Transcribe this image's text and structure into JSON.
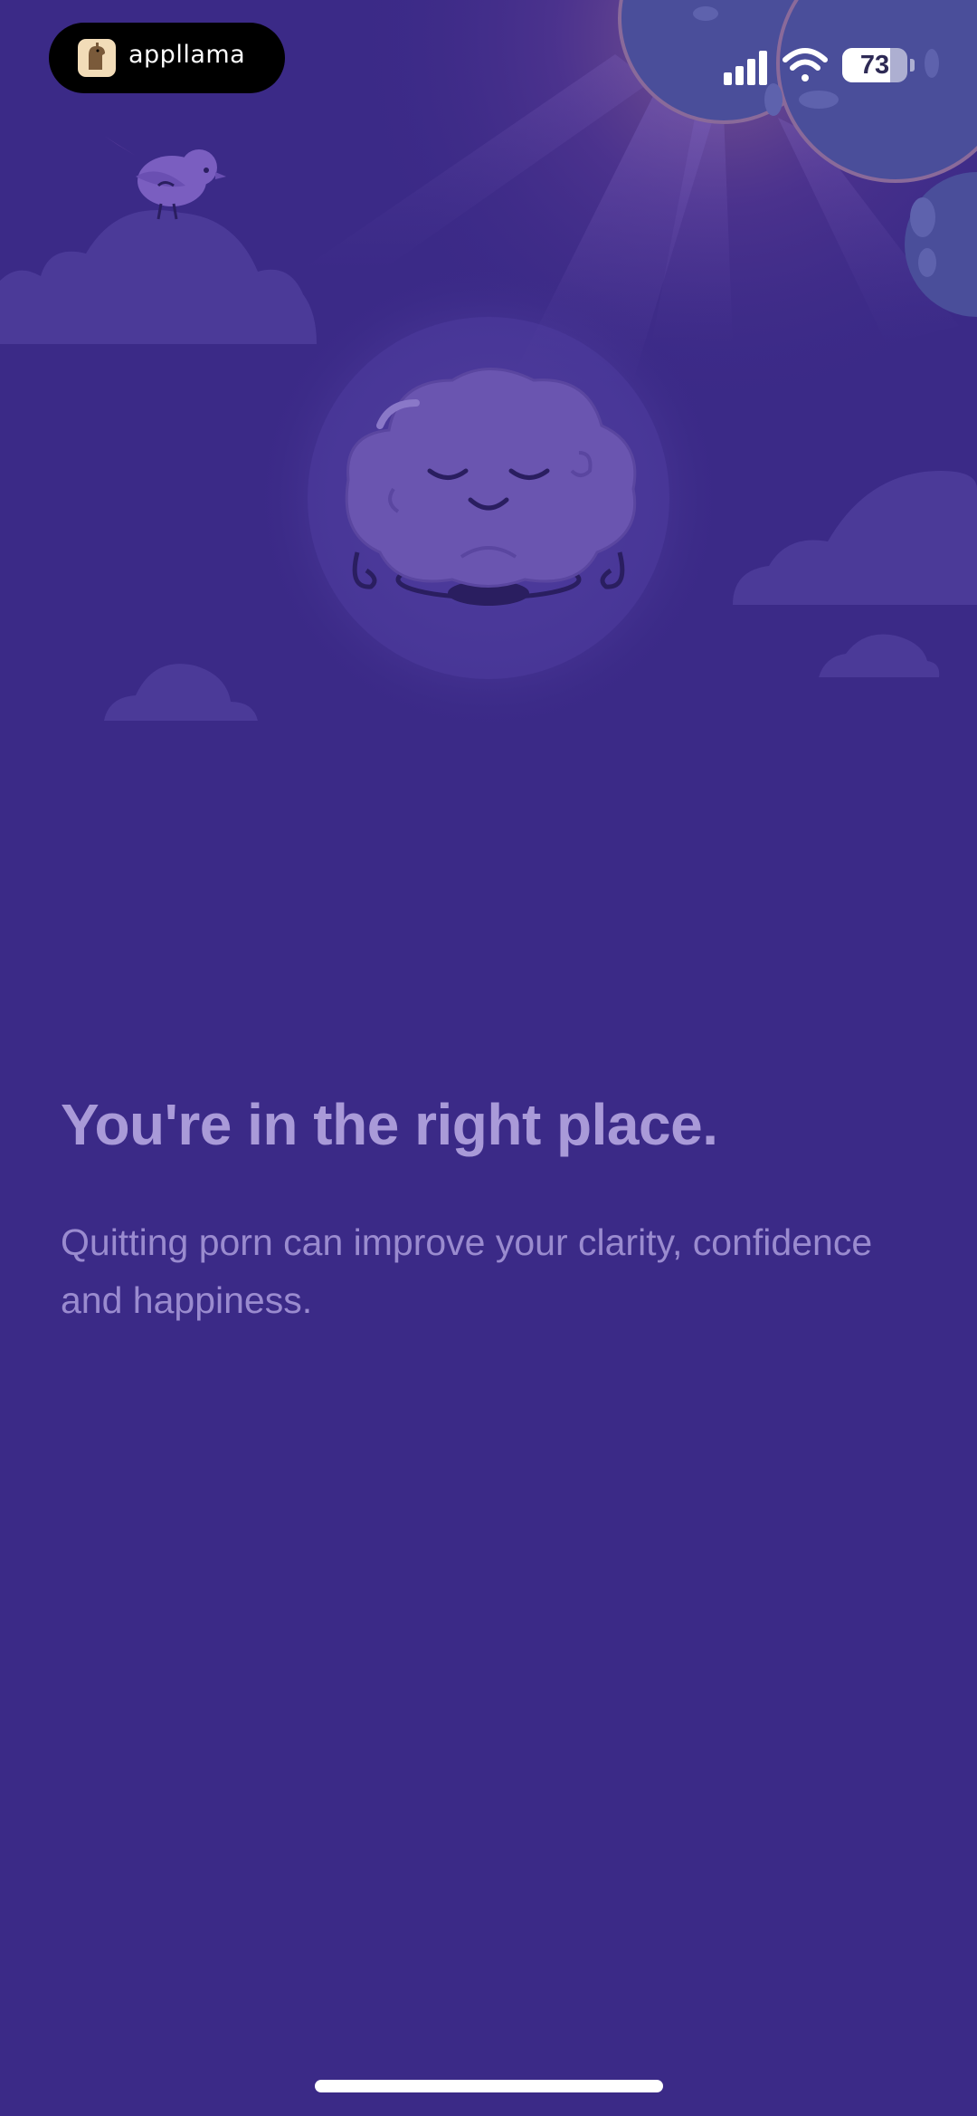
{
  "status_bar": {
    "badge_label": "appllama",
    "battery_level": "73",
    "battery_fraction": 0.73
  },
  "onboarding": {
    "headline": "You're in the right place.",
    "body": "Quitting porn can improve your clarity, confidence and happiness."
  },
  "colors": {
    "background": "#3b2a87",
    "headline": "#a99ad8",
    "body": "#9a8bcf",
    "accent_sun": "#4a4e9a"
  },
  "icons": {
    "status": [
      "cellular-signal-icon",
      "wifi-icon",
      "battery-icon"
    ],
    "illustration": [
      "meditating-brain-mascot",
      "bird-icon",
      "sun-icon",
      "cloud-icon"
    ]
  }
}
